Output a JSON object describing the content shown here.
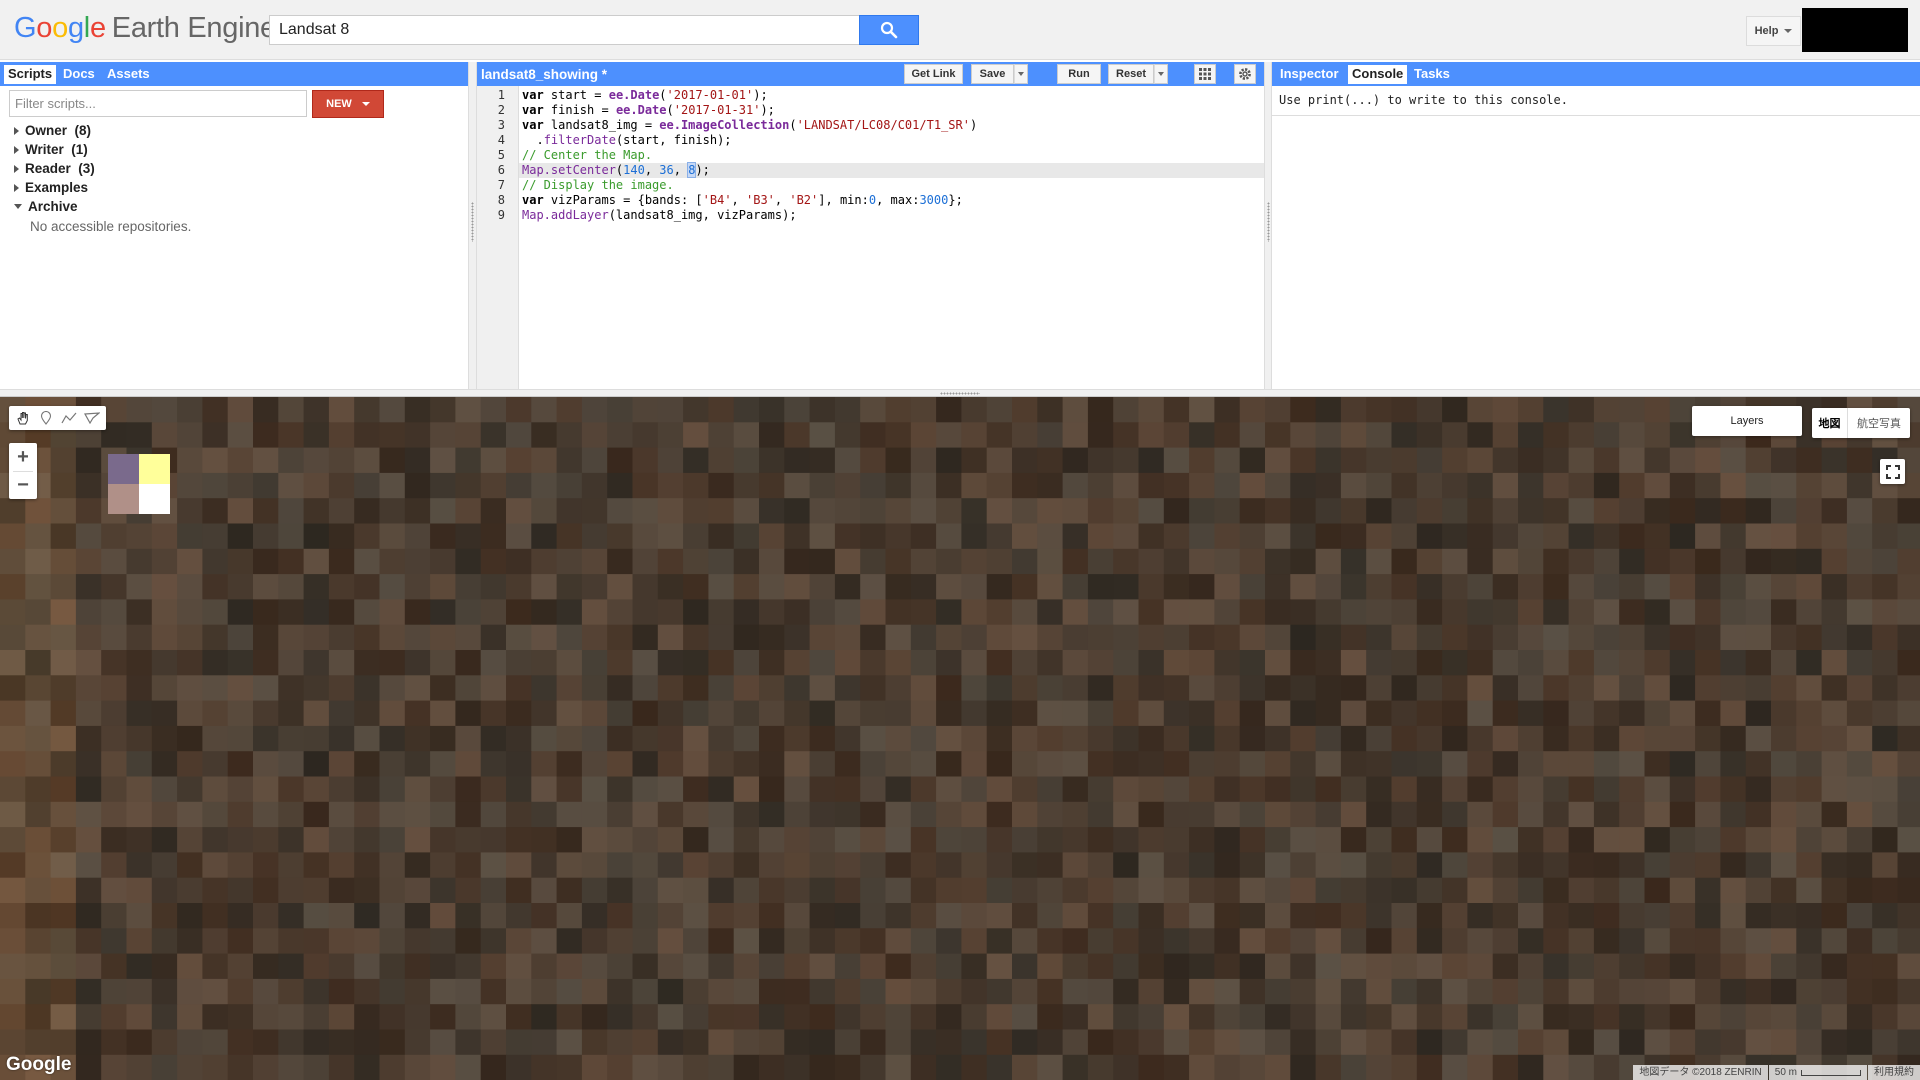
{
  "header": {
    "logo_google": "Google",
    "logo_product": "Earth Engine",
    "search_value": "Landsat 8",
    "help_label": "Help"
  },
  "left_panel": {
    "tabs": [
      {
        "label": "Scripts",
        "active": true
      },
      {
        "label": "Docs",
        "active": false
      },
      {
        "label": "Assets",
        "active": false
      }
    ],
    "filter_placeholder": "Filter scripts...",
    "new_label": "NEW",
    "repos": [
      {
        "label": "Owner  (8)",
        "expanded": false
      },
      {
        "label": "Writer  (1)",
        "expanded": false
      },
      {
        "label": "Reader  (3)",
        "expanded": false
      },
      {
        "label": "Examples",
        "expanded": false
      },
      {
        "label": "Archive",
        "expanded": true
      }
    ],
    "archive_empty": "No accessible repositories."
  },
  "editor": {
    "script_name": "landsat8_showing *",
    "buttons": {
      "get_link": "Get Link",
      "save": "Save",
      "run": "Run",
      "reset": "Reset"
    },
    "active_line": 6,
    "line_numbers": [
      "1",
      "2",
      "3",
      "4",
      "5",
      "6",
      "7",
      "8",
      "9"
    ],
    "code": {
      "l1_kw": "var",
      "l1_a": " start = ",
      "l1_fn": "ee.Date",
      "l1_str": "'2017-01-01'",
      "l1_end": ");",
      "l2_kw": "var",
      "l2_a": " finish = ",
      "l2_fn": "ee.Date",
      "l2_str": "'2017-01-31'",
      "l2_end": ");",
      "l3_kw": "var",
      "l3_a": " landsat8_img = ",
      "l3_fn": "ee.ImageCollection",
      "l3_str": "'LANDSAT/LC08/C01/T1_SR'",
      "l3_end": ")",
      "l4_pre": "  .",
      "l4_mth": "filterDate",
      "l4_end": "(start, finish);",
      "l5_cm": "// Center the Map.",
      "l6_mth": "Map.setCenter",
      "l6_n1": "140",
      "l6_n2": "36",
      "l6_n3": "8",
      "l6_end": ");",
      "l7_cm": "// Display the image.",
      "l8_kw": "var",
      "l8_a": " vizParams = {bands: [",
      "l8_s1": "'B4'",
      "l8_s2": "'B3'",
      "l8_s3": "'B2'",
      "l8_b": "], min:",
      "l8_n1": "0",
      "l8_c": ", max:",
      "l8_n2": "3000",
      "l8_end": "};",
      "l9_mth": "Map.addLayer",
      "l9_end": "(landsat8_img, vizParams);"
    }
  },
  "right_panel": {
    "tabs": [
      {
        "label": "Inspector",
        "active": false
      },
      {
        "label": "Console",
        "active": true
      },
      {
        "label": "Tasks",
        "active": false
      }
    ],
    "console_message": "Use print(...) to write to this console."
  },
  "map": {
    "layers_label": "Layers",
    "map_type_map": "地図",
    "map_type_satellite": "航空写真",
    "google_logo": "Google",
    "attribution": "地図データ ©2018 ZENRIN",
    "scale_label": "50 m",
    "terms": "利用規約",
    "zoom_in": "+",
    "zoom_out": "−"
  },
  "colors": {
    "accent_blue": "#4d90fe",
    "new_red": "#d14836",
    "map_base": "#4a3c30"
  },
  "icons": [
    "search-icon",
    "apps-grid-icon",
    "gear-icon",
    "hand-icon",
    "marker-icon",
    "polyline-icon",
    "polygon-icon",
    "fullscreen-icon"
  ]
}
